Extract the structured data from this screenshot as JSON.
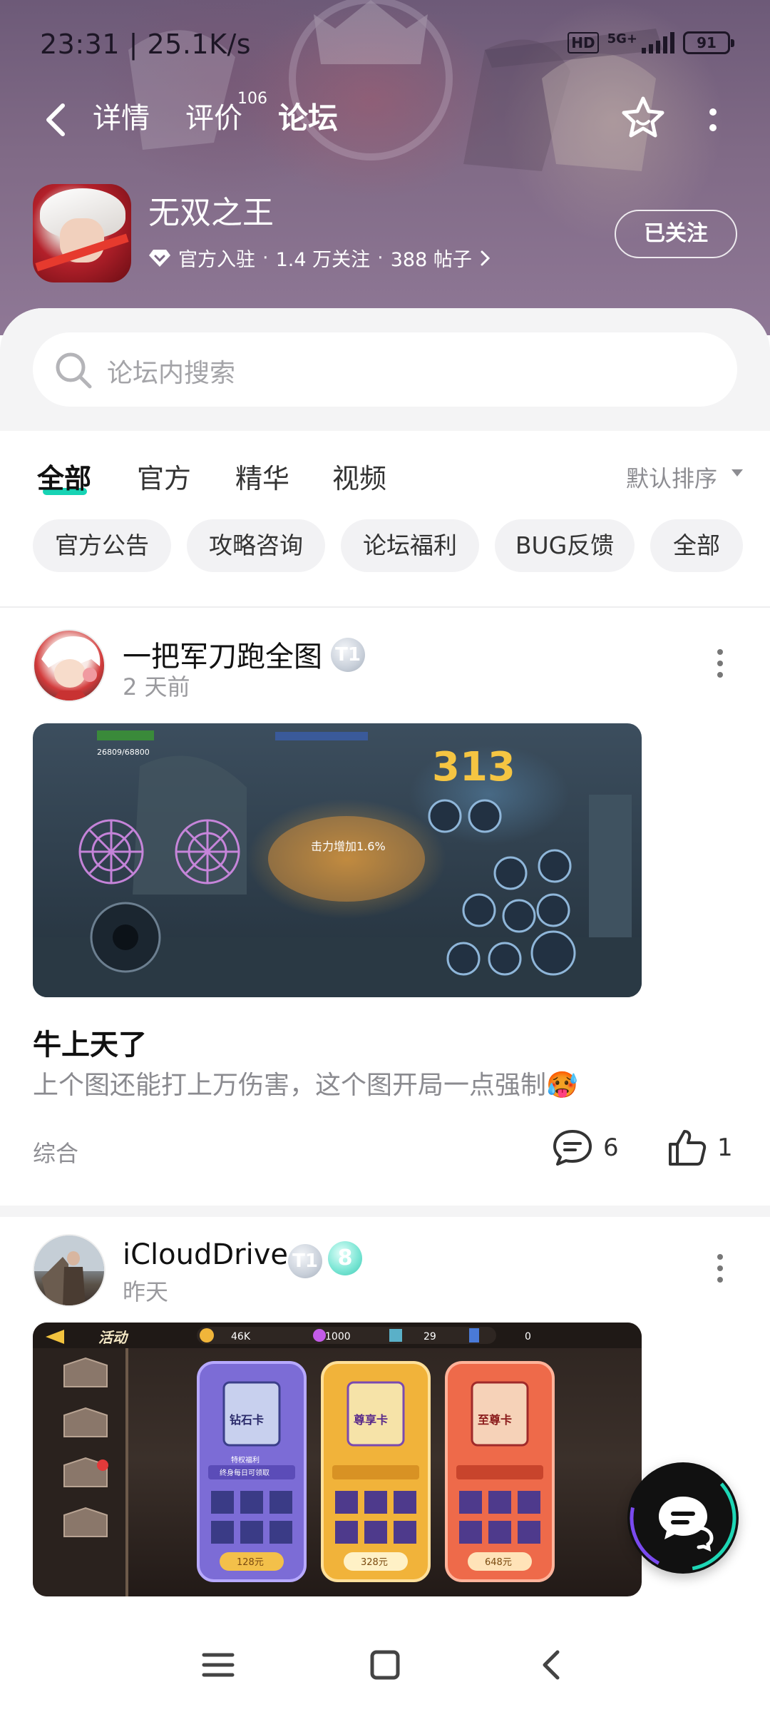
{
  "status_bar": {
    "time": "23:31 | 25.1K/s",
    "hd": "HD",
    "network": "5G+",
    "battery": "91"
  },
  "top_nav": {
    "tabs": [
      {
        "label": "详情"
      },
      {
        "label": "评价",
        "count": "106"
      },
      {
        "label": "论坛"
      }
    ]
  },
  "game": {
    "title": "无双之王",
    "official": "官方入驻",
    "followers": "1.4 万关注",
    "posts": "388 帖子",
    "follow_button": "已关注"
  },
  "search": {
    "placeholder": "论坛内搜索"
  },
  "filter_tabs": [
    {
      "label": "全部"
    },
    {
      "label": "官方"
    },
    {
      "label": "精华"
    },
    {
      "label": "视频"
    }
  ],
  "sort": {
    "label": "默认排序"
  },
  "chips": [
    {
      "label": "官方公告"
    },
    {
      "label": "攻略咨询"
    },
    {
      "label": "论坛福利"
    },
    {
      "label": "BUG反馈"
    },
    {
      "label": "全部"
    }
  ],
  "posts": [
    {
      "author": "一把军刀跑全图",
      "badges": [
        "T1"
      ],
      "time": "2 天前",
      "title": "牛上天了",
      "body": "上个图还能打上万伤害，这个图开局一点强制🥵",
      "tag": "综合",
      "comments": "6",
      "likes": "1",
      "image_texts": {
        "damage": "313",
        "buff": "击力增加1.6%",
        "hp": "26809/68800"
      }
    },
    {
      "author": "iCloudDrive",
      "badges": [
        "T1",
        "8"
      ],
      "time": "昨天",
      "image_texts": {
        "header": "活动",
        "gold": "46K",
        "gems": "1000",
        "items": "29",
        "tickets": "0",
        "cards": [
          {
            "name": "钻石卡",
            "price": "128元"
          },
          {
            "name": "尊享卡",
            "price": "328元"
          },
          {
            "name": "至尊卡",
            "price": "648元"
          }
        ],
        "card_sub": "特权福利",
        "card_sub2": "终身每日可领取"
      }
    }
  ],
  "colors": {
    "accent": "#17d3b4",
    "hero": "#7a6583"
  }
}
